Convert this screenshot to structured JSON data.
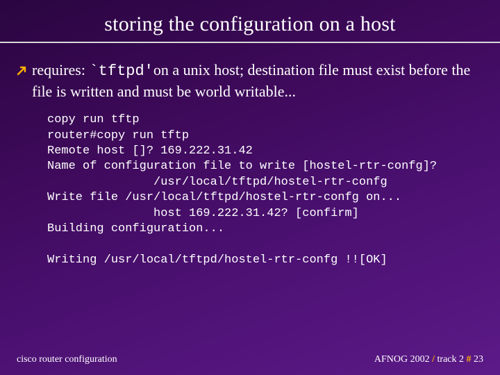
{
  "title": "storing the configuration on a host",
  "bullet": {
    "pre": "requires: ",
    "code": "`tftpd'",
    "post": "on a unix host; destination file must exist before the file is written and must be world writable..."
  },
  "terminal": "copy run tftp\nrouter#copy run tftp\nRemote host []? 169.222.31.42\nName of configuration file to write [hostel-rtr-confg]?\n               /usr/local/tftpd/hostel-rtr-confg\nWrite file /usr/local/tftpd/hostel-rtr-confg on...\n               host 169.222.31.42? [confirm]\nBuilding configuration...\n\nWriting /usr/local/tftpd/hostel-rtr-confg !![OK]",
  "footer": {
    "left": "cisco router configuration",
    "right_event": "AFNOG 2002",
    "right_sep1": " / ",
    "right_track": "track 2 ",
    "right_hash": "#",
    "right_page": " 23"
  },
  "colors": {
    "accent": "#ffb000"
  }
}
